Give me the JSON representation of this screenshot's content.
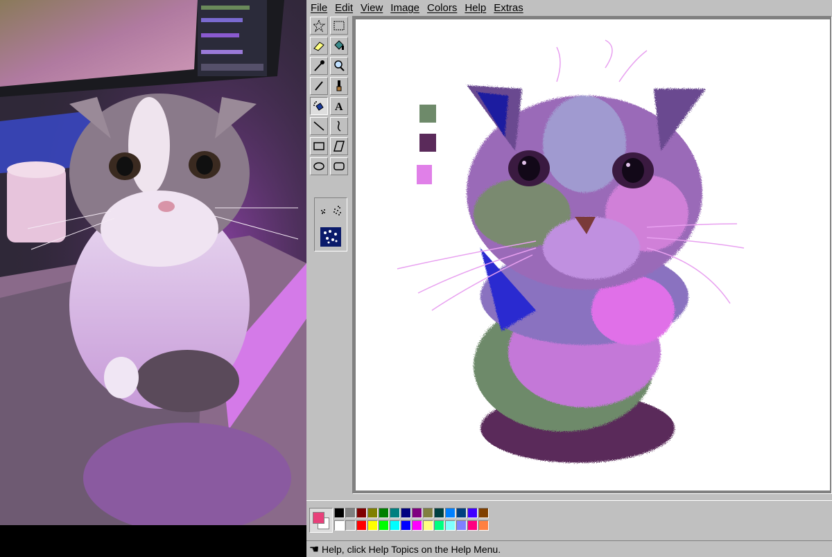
{
  "menu": [
    "File",
    "Edit",
    "View",
    "Image",
    "Colors",
    "Help",
    "Extras"
  ],
  "tools": [
    {
      "id": "free-select",
      "icon": "star-select-icon"
    },
    {
      "id": "rect-select",
      "icon": "rect-select-icon"
    },
    {
      "id": "eraser",
      "icon": "eraser-icon"
    },
    {
      "id": "fill",
      "icon": "fill-bucket-icon"
    },
    {
      "id": "pick-color",
      "icon": "eyedropper-icon"
    },
    {
      "id": "magnifier",
      "icon": "magnifier-icon"
    },
    {
      "id": "pencil",
      "icon": "pencil-icon"
    },
    {
      "id": "brush",
      "icon": "brush-icon"
    },
    {
      "id": "airbrush",
      "icon": "airbrush-icon"
    },
    {
      "id": "text",
      "icon": "text-icon"
    },
    {
      "id": "line",
      "icon": "line-icon"
    },
    {
      "id": "curve",
      "icon": "curve-icon"
    },
    {
      "id": "rectangle",
      "icon": "rectangle-icon"
    },
    {
      "id": "polygon",
      "icon": "polygon-icon"
    },
    {
      "id": "ellipse",
      "icon": "ellipse-icon"
    },
    {
      "id": "rounded-rect",
      "icon": "rounded-rectangle-icon"
    }
  ],
  "active_tool": "airbrush",
  "foreground_color": "#e8407a",
  "background_color": "#ffffff",
  "palette_top": [
    "#000000",
    "#808080",
    "#800000",
    "#808000",
    "#008000",
    "#008080",
    "#000080",
    "#800080",
    "#808040",
    "#004040",
    "#0080ff",
    "#004080",
    "#4000ff",
    "#804000"
  ],
  "palette_bottom": [
    "#ffffff",
    "#c0c0c0",
    "#ff0000",
    "#ffff00",
    "#00ff00",
    "#00ffff",
    "#0000ff",
    "#ff00ff",
    "#ffff80",
    "#00ff80",
    "#80ffff",
    "#8080ff",
    "#ff0080",
    "#ff8040"
  ],
  "status_text": "Help, click Help Topics on the Help Menu."
}
